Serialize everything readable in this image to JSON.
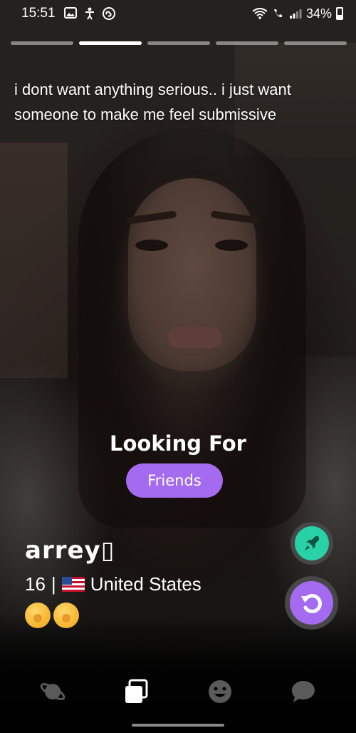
{
  "status_bar": {
    "time": "15:51",
    "battery": "34%",
    "left_icons": [
      "gallery-icon",
      "accessibility-icon",
      "shazam-icon"
    ],
    "right_icons": [
      "wifi-icon",
      "call-icon",
      "signal-icon",
      "battery-icon"
    ]
  },
  "story_progress": {
    "total": 5,
    "active_index": 1
  },
  "profile": {
    "bio": "i dont want anything serious.. i just want someone to make me feel submissive",
    "looking_for_label": "Looking For",
    "looking_for_value": "Friends",
    "name": "arrey▯",
    "age": "16",
    "separator": "|",
    "country": "United States",
    "flag_icon": "us-flag-icon",
    "emojis": [
      "shushing-face-emoji",
      "hand-over-mouth-emoji"
    ]
  },
  "actions": {
    "boost_icon": "rocket-icon",
    "rewind_icon": "rewind-icon"
  },
  "navbar": {
    "items": [
      {
        "icon": "planet-icon"
      },
      {
        "icon": "cards-icon"
      },
      {
        "icon": "smiley-icon"
      },
      {
        "icon": "chat-icon"
      }
    ]
  },
  "colors": {
    "accent_purple": "#a46bf0",
    "boost_green": "#28d2a6",
    "action_ring": "#474747"
  }
}
